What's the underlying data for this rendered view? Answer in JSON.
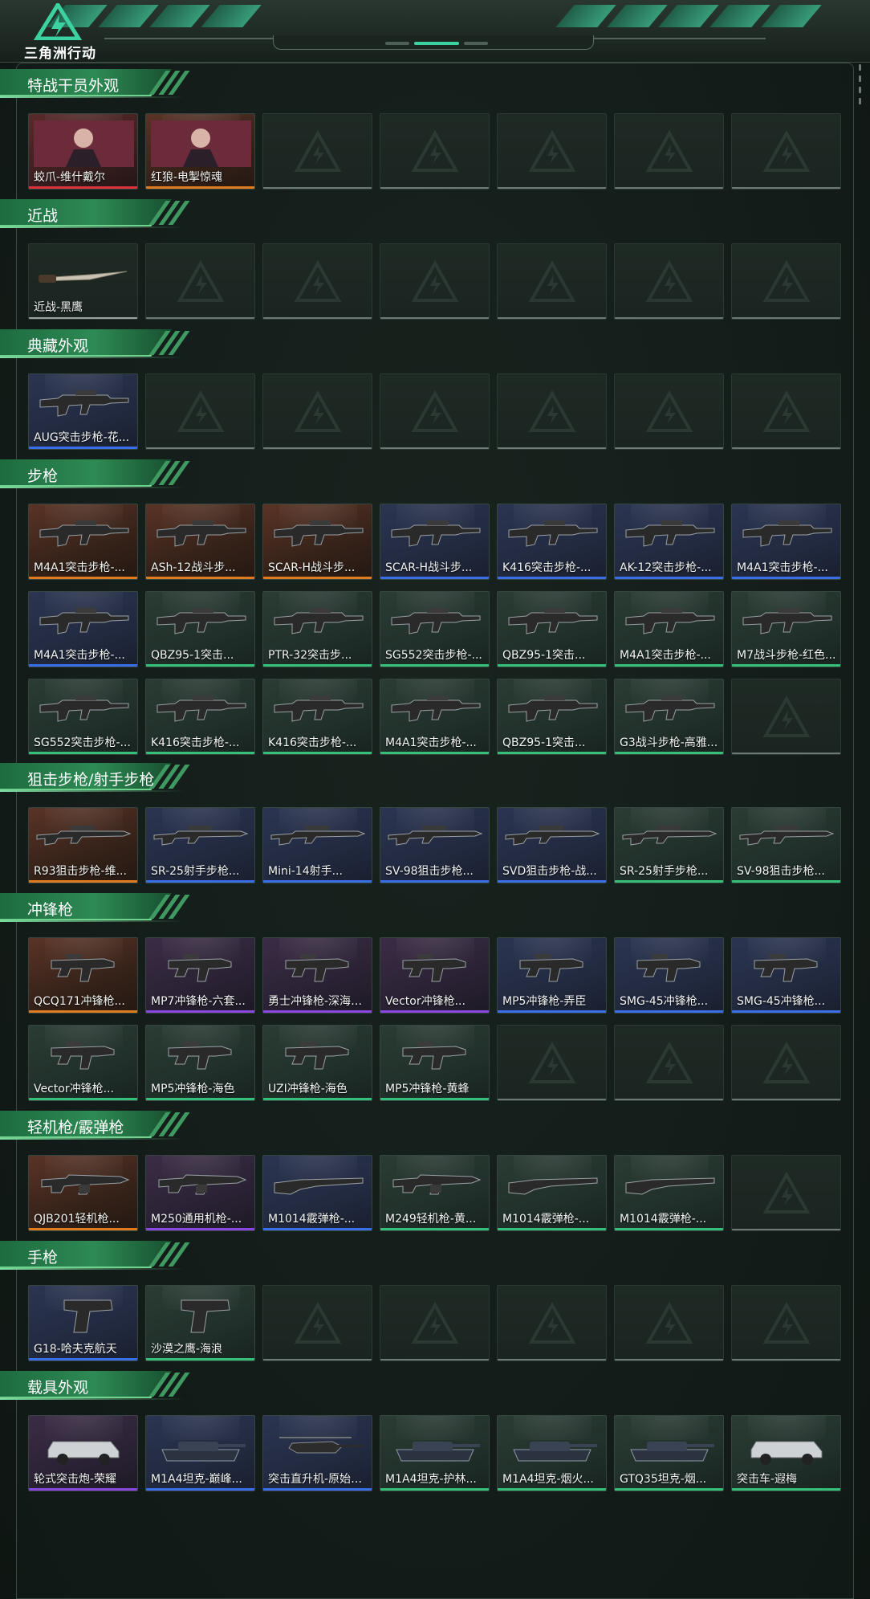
{
  "app": {
    "logo_text": "三角洲行动"
  },
  "sections": [
    {
      "title": "特战干员外观",
      "rows": [
        [
          {
            "label": "蛟爪-维什戴尔",
            "rarity": "red",
            "icon": "operator-skin"
          },
          {
            "label": "红狼-电掣惊魂",
            "rarity": "gold",
            "icon": "operator-skin"
          },
          {
            "label": "",
            "rarity": "empty"
          },
          {
            "label": "",
            "rarity": "empty"
          },
          {
            "label": "",
            "rarity": "empty"
          },
          {
            "label": "",
            "rarity": "empty"
          },
          {
            "label": "",
            "rarity": "empty"
          }
        ]
      ]
    },
    {
      "title": "近战",
      "rows": [
        [
          {
            "label": "近战-黑鹰",
            "rarity": "empty-green",
            "icon": "knife"
          },
          {
            "label": "",
            "rarity": "empty"
          },
          {
            "label": "",
            "rarity": "empty"
          },
          {
            "label": "",
            "rarity": "empty"
          },
          {
            "label": "",
            "rarity": "empty"
          },
          {
            "label": "",
            "rarity": "empty"
          },
          {
            "label": "",
            "rarity": "empty"
          }
        ]
      ]
    },
    {
      "title": "典藏外观",
      "rows": [
        [
          {
            "label": "AUG突击步枪-花...",
            "rarity": "blue",
            "icon": "rifle"
          },
          {
            "label": "",
            "rarity": "empty"
          },
          {
            "label": "",
            "rarity": "empty"
          },
          {
            "label": "",
            "rarity": "empty"
          },
          {
            "label": "",
            "rarity": "empty"
          },
          {
            "label": "",
            "rarity": "empty"
          },
          {
            "label": "",
            "rarity": "empty"
          }
        ]
      ]
    },
    {
      "title": "步枪",
      "rows": [
        [
          {
            "label": "M4A1突击步枪-...",
            "rarity": "gold",
            "icon": "rifle"
          },
          {
            "label": "ASh-12战斗步...",
            "rarity": "gold",
            "icon": "rifle"
          },
          {
            "label": "SCAR-H战斗步...",
            "rarity": "gold",
            "icon": "rifle"
          },
          {
            "label": "SCAR-H战斗步...",
            "rarity": "blue",
            "icon": "rifle"
          },
          {
            "label": "K416突击步枪-...",
            "rarity": "blue",
            "icon": "rifle"
          },
          {
            "label": "AK-12突击步枪-...",
            "rarity": "blue",
            "icon": "rifle"
          },
          {
            "label": "M4A1突击步枪-...",
            "rarity": "blue",
            "icon": "rifle"
          }
        ],
        [
          {
            "label": "M4A1突击步枪-...",
            "rarity": "blue",
            "icon": "rifle"
          },
          {
            "label": "QBZ95-1突击...",
            "rarity": "green",
            "icon": "rifle"
          },
          {
            "label": "PTR-32突击步...",
            "rarity": "green",
            "icon": "rifle"
          },
          {
            "label": "SG552突击步枪-...",
            "rarity": "green",
            "icon": "rifle"
          },
          {
            "label": "QBZ95-1突击...",
            "rarity": "green",
            "icon": "rifle"
          },
          {
            "label": "M4A1突击步枪-...",
            "rarity": "green",
            "icon": "rifle"
          },
          {
            "label": "M7战斗步枪-红色...",
            "rarity": "green",
            "icon": "rifle"
          }
        ],
        [
          {
            "label": "SG552突击步枪-...",
            "rarity": "green",
            "icon": "rifle"
          },
          {
            "label": "K416突击步枪-...",
            "rarity": "green",
            "icon": "rifle"
          },
          {
            "label": "K416突击步枪-...",
            "rarity": "green",
            "icon": "rifle"
          },
          {
            "label": "M4A1突击步枪-...",
            "rarity": "green",
            "icon": "rifle"
          },
          {
            "label": "QBZ95-1突击...",
            "rarity": "green",
            "icon": "rifle"
          },
          {
            "label": "G3战斗步枪-高雅...",
            "rarity": "green",
            "icon": "rifle"
          },
          {
            "label": "",
            "rarity": "empty"
          }
        ]
      ]
    },
    {
      "title": "狙击步枪/射手步枪",
      "rows": [
        [
          {
            "label": "R93狙击步枪-维...",
            "rarity": "gold",
            "icon": "sniper"
          },
          {
            "label": "SR-25射手步枪...",
            "rarity": "blue",
            "icon": "sniper"
          },
          {
            "label": "Mini-14射手...",
            "rarity": "blue",
            "icon": "sniper"
          },
          {
            "label": "SV-98狙击步枪...",
            "rarity": "blue",
            "icon": "sniper"
          },
          {
            "label": "SVD狙击步枪-战...",
            "rarity": "blue",
            "icon": "sniper"
          },
          {
            "label": "SR-25射手步枪...",
            "rarity": "green",
            "icon": "sniper"
          },
          {
            "label": "SV-98狙击步枪...",
            "rarity": "green",
            "icon": "sniper"
          }
        ]
      ]
    },
    {
      "title": "冲锋枪",
      "rows": [
        [
          {
            "label": "QCQ171冲锋枪...",
            "rarity": "gold",
            "icon": "smg"
          },
          {
            "label": "MP7冲锋枪-六套...",
            "rarity": "purple",
            "icon": "smg"
          },
          {
            "label": "勇士冲锋枪-深海恐...",
            "rarity": "purple",
            "icon": "smg"
          },
          {
            "label": "Vector冲锋枪...",
            "rarity": "purple",
            "icon": "smg"
          },
          {
            "label": "MP5冲锋枪-弄臣",
            "rarity": "blue",
            "icon": "smg"
          },
          {
            "label": "SMG-45冲锋枪...",
            "rarity": "blue",
            "icon": "smg"
          },
          {
            "label": "SMG-45冲锋枪...",
            "rarity": "blue",
            "icon": "smg"
          }
        ],
        [
          {
            "label": "Vector冲锋枪...",
            "rarity": "green",
            "icon": "smg"
          },
          {
            "label": "MP5冲锋枪-海色",
            "rarity": "green",
            "icon": "smg"
          },
          {
            "label": "UZI冲锋枪-海色",
            "rarity": "green",
            "icon": "smg"
          },
          {
            "label": "MP5冲锋枪-黄蜂",
            "rarity": "green",
            "icon": "smg"
          },
          {
            "label": "",
            "rarity": "empty"
          },
          {
            "label": "",
            "rarity": "empty"
          },
          {
            "label": "",
            "rarity": "empty"
          }
        ]
      ]
    },
    {
      "title": "轻机枪/霰弹枪",
      "rows": [
        [
          {
            "label": "QJB201轻机枪...",
            "rarity": "gold",
            "icon": "lmg"
          },
          {
            "label": "M250通用机枪-...",
            "rarity": "purple",
            "icon": "lmg"
          },
          {
            "label": "M1014霰弹枪-...",
            "rarity": "blue",
            "icon": "shotgun"
          },
          {
            "label": "M249轻机枪-黄...",
            "rarity": "green",
            "icon": "lmg"
          },
          {
            "label": "M1014霰弹枪-...",
            "rarity": "green",
            "icon": "shotgun"
          },
          {
            "label": "M1014霰弹枪-...",
            "rarity": "green",
            "icon": "shotgun"
          },
          {
            "label": "",
            "rarity": "empty"
          }
        ]
      ]
    },
    {
      "title": "手枪",
      "rows": [
        [
          {
            "label": "G18-哈夫克航天",
            "rarity": "blue",
            "icon": "pistol"
          },
          {
            "label": "沙漠之鹰-海浪",
            "rarity": "green",
            "icon": "pistol"
          },
          {
            "label": "",
            "rarity": "empty"
          },
          {
            "label": "",
            "rarity": "empty"
          },
          {
            "label": "",
            "rarity": "empty"
          },
          {
            "label": "",
            "rarity": "empty"
          },
          {
            "label": "",
            "rarity": "empty"
          }
        ]
      ]
    },
    {
      "title": "载具外观",
      "rows": [
        [
          {
            "label": "轮式突击炮-荣耀",
            "rarity": "purple",
            "icon": "vehicle"
          },
          {
            "label": "M1A4坦克-巅峰...",
            "rarity": "blue",
            "icon": "tank"
          },
          {
            "label": "突击直升机-原始伪...",
            "rarity": "blue",
            "icon": "helicopter"
          },
          {
            "label": "M1A4坦克-护林...",
            "rarity": "green",
            "icon": "tank"
          },
          {
            "label": "M1A4坦克-烟火...",
            "rarity": "green",
            "icon": "tank"
          },
          {
            "label": "GTQ35坦克-烟...",
            "rarity": "green",
            "icon": "tank"
          },
          {
            "label": "突击车-遐梅",
            "rarity": "green",
            "icon": "vehicle"
          }
        ]
      ]
    }
  ],
  "colors": {
    "accent": "#34c07a",
    "rarity_gold": "#e07b1f",
    "rarity_purple": "#8a46e0",
    "rarity_blue": "#3a6de8",
    "rarity_green": "#34c07a",
    "rarity_red": "#d8343a"
  }
}
